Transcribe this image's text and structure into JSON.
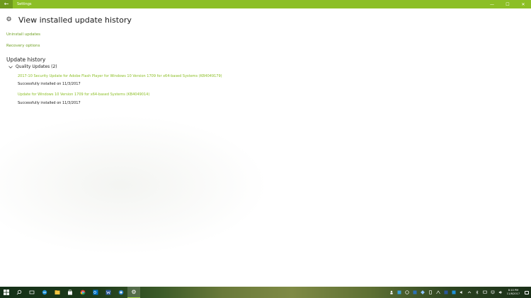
{
  "window": {
    "app_title": "Settings",
    "back_glyph": "←",
    "min_glyph": "—",
    "max_glyph": "☐",
    "close_glyph": "✕"
  },
  "header": {
    "icon": "gear-icon",
    "title": "View installed update history"
  },
  "links": {
    "uninstall": "Uninstall updates",
    "recovery": "Recovery options"
  },
  "history": {
    "section_title": "Update history",
    "group_label": "Quality Updates (2)",
    "items": [
      {
        "title": "2017-10 Security Update for Adobe Flash Player for Windows 10 Version 1709 for x64-based Systems (KB4049179)",
        "status": "Successfully installed on 11/3/2017"
      },
      {
        "title": "Update for Windows 10 Version 1709 for x64-based Systems (KB4049014)",
        "status": "Successfully installed on 11/3/2017"
      }
    ]
  },
  "taskbar": {
    "clock_time": "8:10 PM",
    "clock_date": "11/6/2017"
  },
  "colors": {
    "accent": "#8cbf26",
    "link": "#6ea021"
  }
}
